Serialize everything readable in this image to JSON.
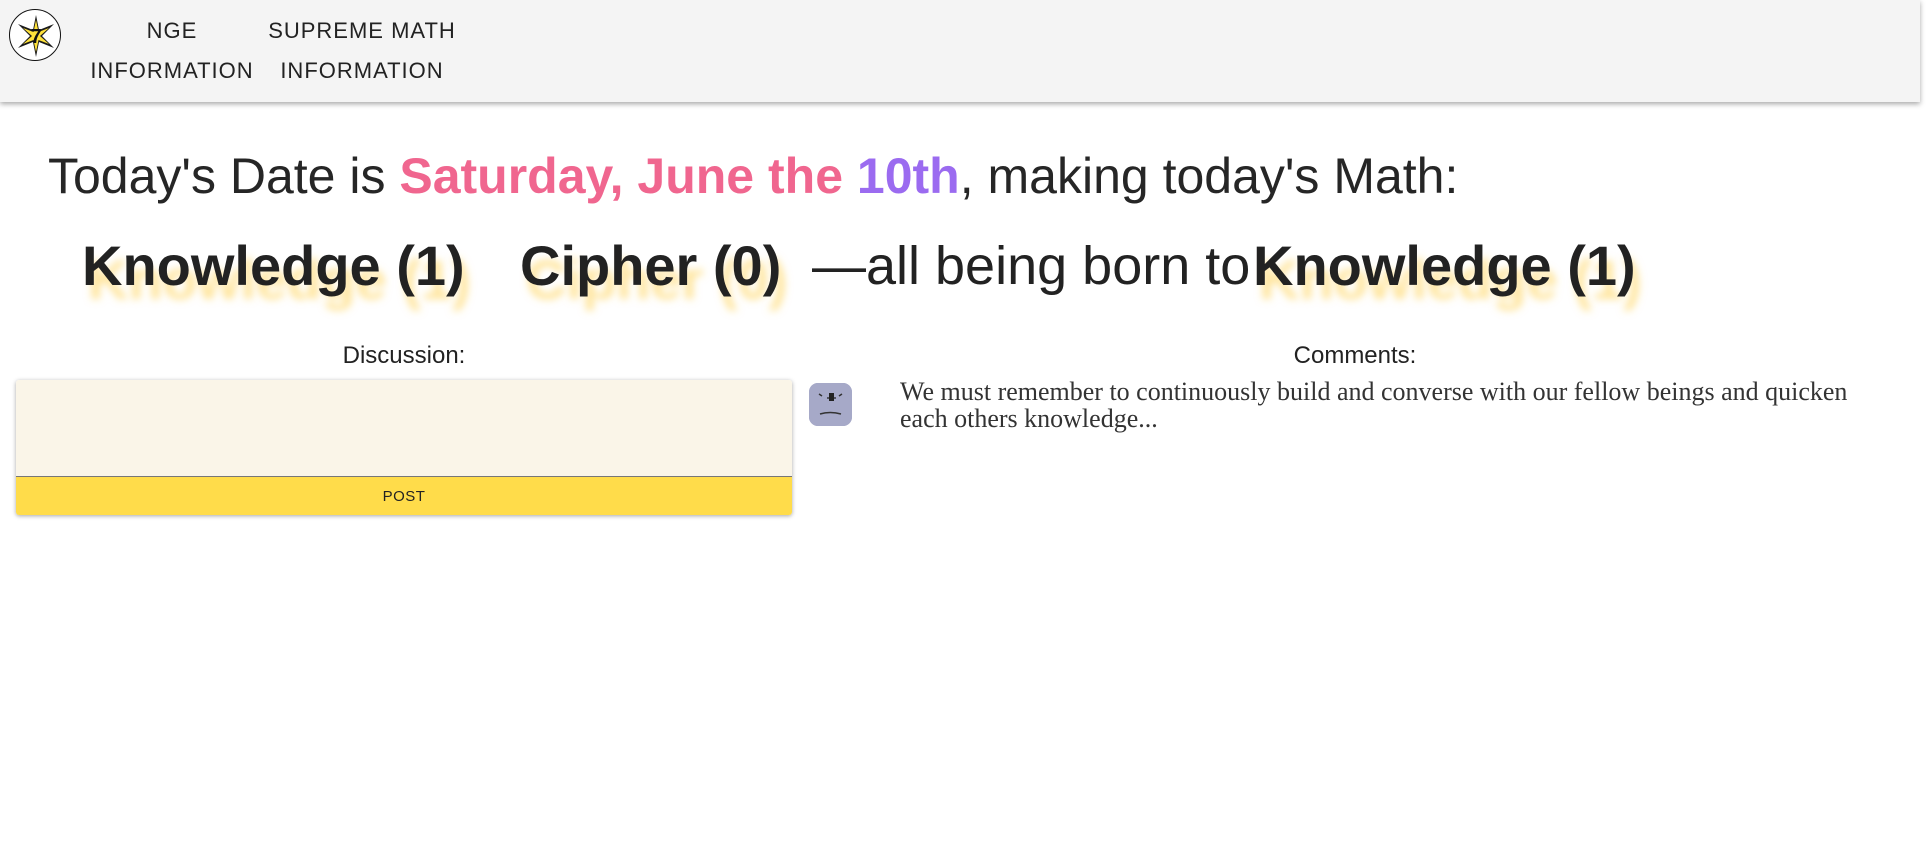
{
  "nav": {
    "logo_icon": "seven-star-compass-logo-icon",
    "links": [
      {
        "line1": "NGE",
        "line2": "INFORMATION"
      },
      {
        "line1": "SUPREME MATH",
        "line2": "INFORMATION"
      }
    ]
  },
  "headline": {
    "prefix": "Today's Date is ",
    "day": "Saturday, June the ",
    "ordinal": "10th",
    "suffix": ", making today's Math:",
    "day_color": "#f0668f",
    "ordinal_color": "#9b6bf0"
  },
  "math": {
    "first": "Knowledge (1)",
    "second": "Cipher (0)",
    "connector": "—all being born to",
    "result": "Knowledge (1)",
    "glow_color": "#ffcd46"
  },
  "discussion": {
    "label": "Discussion:",
    "input_value": "",
    "input_placeholder": "",
    "post_label": "POST",
    "input_bg": "#faf5e8",
    "button_bg": "#ffdc4a"
  },
  "comments": {
    "label": "Comments:",
    "items": [
      {
        "avatar_icon": "robot-avatar-icon",
        "text": "We must remember to continuously build and converse with our fellow beings and quicken each others knowledge..."
      }
    ]
  }
}
